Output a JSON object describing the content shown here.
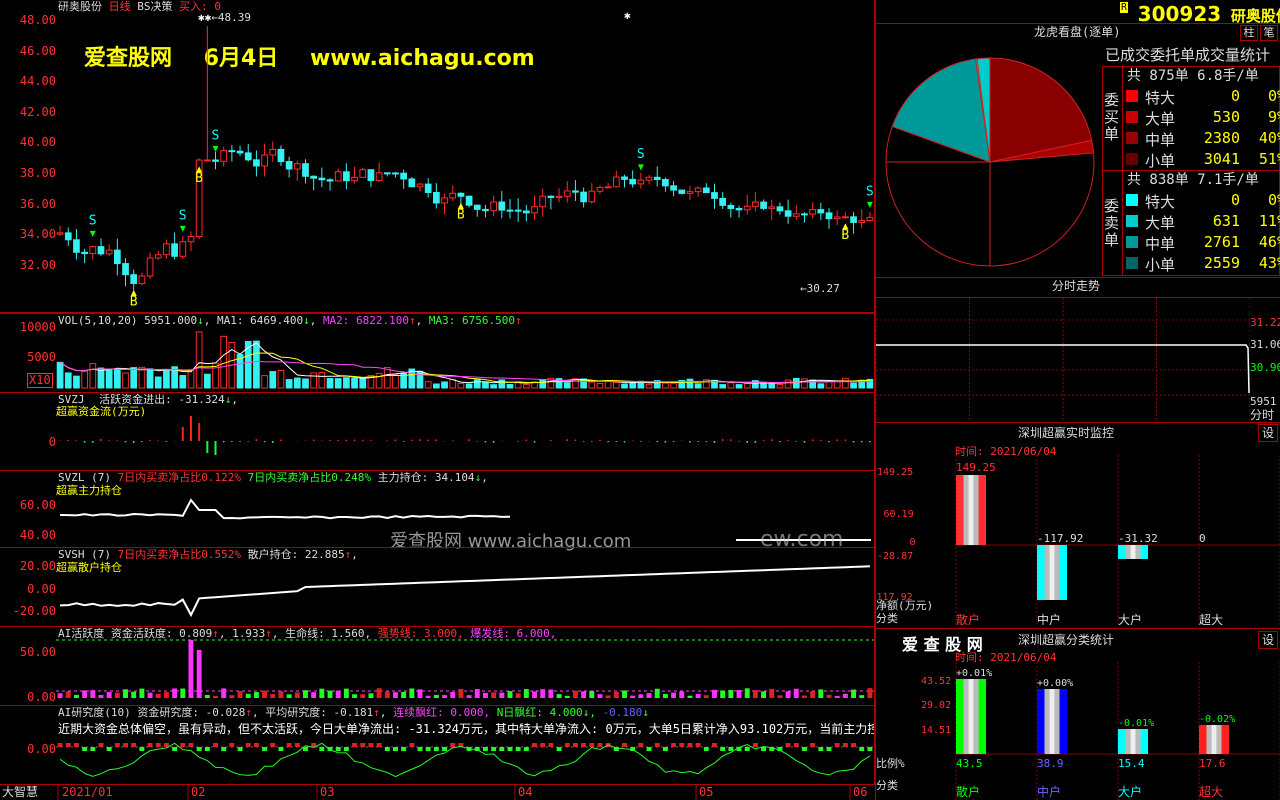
{
  "stock": {
    "title": "研奥股份",
    "line_mode": "日线",
    "strategy": "BS决策",
    "buy_label": "买入: 0",
    "high_label": "48.39",
    "low_label": "30.27",
    "code": "300923",
    "r_badge": "R"
  },
  "watermark": {
    "site": "爱查股网",
    "date": "6月4日",
    "url": "www.aichagu.com",
    "center_text": "爱查股网   www.aichagu.com",
    "center_tail": "ew.com",
    "brand_spaced": "爱 查 股 网"
  },
  "main_chart": {
    "y_labels": [
      "48.00",
      "46.00",
      "44.00",
      "42.00",
      "40.00",
      "38.00",
      "36.00",
      "34.00",
      "32.00"
    ],
    "sig_b": "B",
    "sig_s": "S"
  },
  "vol_panel": {
    "title": "VOL(5,10,20)",
    "value": "5951.000",
    "ma1": "MA1: 6469.400",
    "ma2": "MA2: 6822.100",
    "ma3": "MA3: 6756.500",
    "y_labels": [
      "10000",
      "5000"
    ],
    "unit": "X10",
    "arrow_down": "↓",
    "arrow_up": "↑"
  },
  "svzj": {
    "title": "SVZJ",
    "desc": "活跃资金进出: -31.324",
    "sub": "超赢资金流(万元)",
    "zero": "0",
    "arrow_down": "↓",
    "comma": ","
  },
  "svzl": {
    "title": "SVZL (7)",
    "a": "7日内买卖净占比0.122%",
    "b": "7日内买卖净占比0.248%",
    "c": "主力持仓: 34.104",
    "sub": "超赢主力持仓",
    "y_labels": [
      "60.00",
      "40.00"
    ],
    "arrow_down": "↓",
    "comma": ","
  },
  "svsh": {
    "title": "SVSH (7)",
    "a": "7日内买卖净占比0.552%",
    "b": "散户持仓: 22.885",
    "sub": "超赢散户持仓",
    "y_labels": [
      "20.00",
      "0.00",
      "-20.00"
    ],
    "arrow_up": "↑",
    "comma": ","
  },
  "ai_act": {
    "title": "AI活跃度",
    "a": "资金活跃度: 0.809",
    "b": "1.933",
    "c": "生命线: 1.560",
    "d": "强势线: 3.000",
    "e": "爆发线: 6.000",
    "y_labels": [
      "50.00",
      "0.00"
    ],
    "arrow_up": "↑",
    "comma": ","
  },
  "ai_res": {
    "title": "AI研究度(10)",
    "a": "资金研究度: -0.028",
    "b": "平均研究度: -0.181",
    "c": "连续飘红: 0.000",
    "d": "N日飘红: 4.000",
    "e": "-0.180",
    "arrow_down": "↓",
    "arrow_up": "↑",
    "comma": ",",
    "comment": "近期大资金总体偏空，虽有异动，但不太活跃，今日大单净流出: -31.324万元，其中特大单净流入: 0万元，大单5日累计净入93.102万元，当前主力控盘弱",
    "zero": "0.00"
  },
  "bottom_axis": {
    "brand": "大智慧",
    "dates": [
      "2021/01",
      "02",
      "03",
      "04",
      "05",
      "06"
    ]
  },
  "right_panel": {
    "lhb_title": "龙虎看盘(逐单)",
    "tab_col": "柱",
    "tab_note": "笔",
    "deal_title": "已成交委托单成交量统计",
    "buy": {
      "label": "委买单",
      "header": "共 875单 6.8手/单",
      "rows": [
        {
          "name": "特大",
          "count": "0",
          "pct": "0%",
          "color": "#ff0000"
        },
        {
          "name": "大单",
          "count": "530",
          "pct": "9%",
          "color": "#cc0000"
        },
        {
          "name": "中单",
          "count": "2380",
          "pct": "40%",
          "color": "#990000"
        },
        {
          "name": "小单",
          "count": "3041",
          "pct": "51%",
          "color": "#660000"
        }
      ]
    },
    "sell": {
      "label": "委卖单",
      "header": "共 838单 7.1手/单",
      "rows": [
        {
          "name": "特大",
          "count": "0",
          "pct": "0%",
          "color": "#00ffff"
        },
        {
          "name": "大单",
          "count": "631",
          "pct": "11%",
          "color": "#00cccc"
        },
        {
          "name": "中单",
          "count": "2761",
          "pct": "46%",
          "color": "#009999"
        },
        {
          "name": "小单",
          "count": "2559",
          "pct": "43%",
          "color": "#006666"
        }
      ]
    },
    "intraday_title": "分时走势",
    "intraday_y": [
      "31.22",
      "31.06",
      "30.90"
    ],
    "intraday_vol": "5951",
    "intraday_x": "分时",
    "monitor_title": "深圳超赢实时监控",
    "set_label": "设",
    "time_label": "时间: 2021/06/04",
    "monitor_y": [
      "149.25",
      "60.19",
      "0",
      "-28.87",
      "-117.92"
    ],
    "monitor_values": [
      "149.25",
      "-117.92",
      "-31.32",
      "0"
    ],
    "monitor_ylabel": "净额(万元)",
    "monitor_xlabel": "分类",
    "categories": [
      "散户",
      "中户",
      "大户",
      "超大"
    ],
    "stat_title": "深圳超赢分类统计",
    "stat_y": [
      "43.52",
      "29.02",
      "14.51"
    ],
    "stat_changes": [
      "+0.01%",
      "+0.00%",
      "-0.01%",
      "-0.02%"
    ],
    "stat_values": [
      "43.5",
      "38.9",
      "15.4",
      "17.6"
    ],
    "stat_ylabel": "比例%",
    "stat_xlabel": "分类"
  }
}
